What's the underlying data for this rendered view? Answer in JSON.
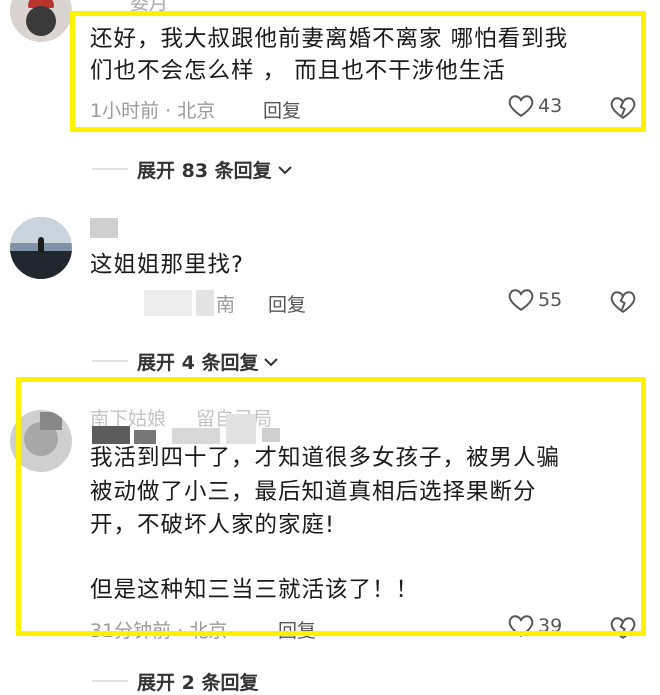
{
  "comments": [
    {
      "username": "娄月",
      "text_line1": "还好，我大叔跟他前妻离婚不离家 哪怕看到我",
      "text_line2": "们也不会怎么样 ， 而且也不干涉他生活",
      "meta": "1小时前 · 北京",
      "reply": "回复",
      "likes": "43",
      "expand": "展开 83 条回复"
    },
    {
      "text": "这姐姐那里找?",
      "meta": "南",
      "reply": "回复",
      "likes": "55",
      "expand": "展开 4 条回复"
    },
    {
      "username": "南下姑娘",
      "username_suffix": "留自己局",
      "text_line1": "我活到四十了，才知道很多女孩子，被男人骗",
      "text_line2": "被动做了小三，最后知道真相后选择果断分",
      "text_line3": "开，不破坏人家的家庭!",
      "text_line4": "但是这种知三当三就活该了！！",
      "meta": "31分钟前 · 北京",
      "reply": "回复",
      "likes": "39",
      "expand": "展开 2 条回复"
    }
  ],
  "colors": {
    "highlight": "#fff200",
    "meta": "#9a9a9a",
    "text": "#1a1a1a"
  },
  "icons": [
    "heart-icon",
    "broken-heart-icon",
    "chevron-down-icon"
  ]
}
